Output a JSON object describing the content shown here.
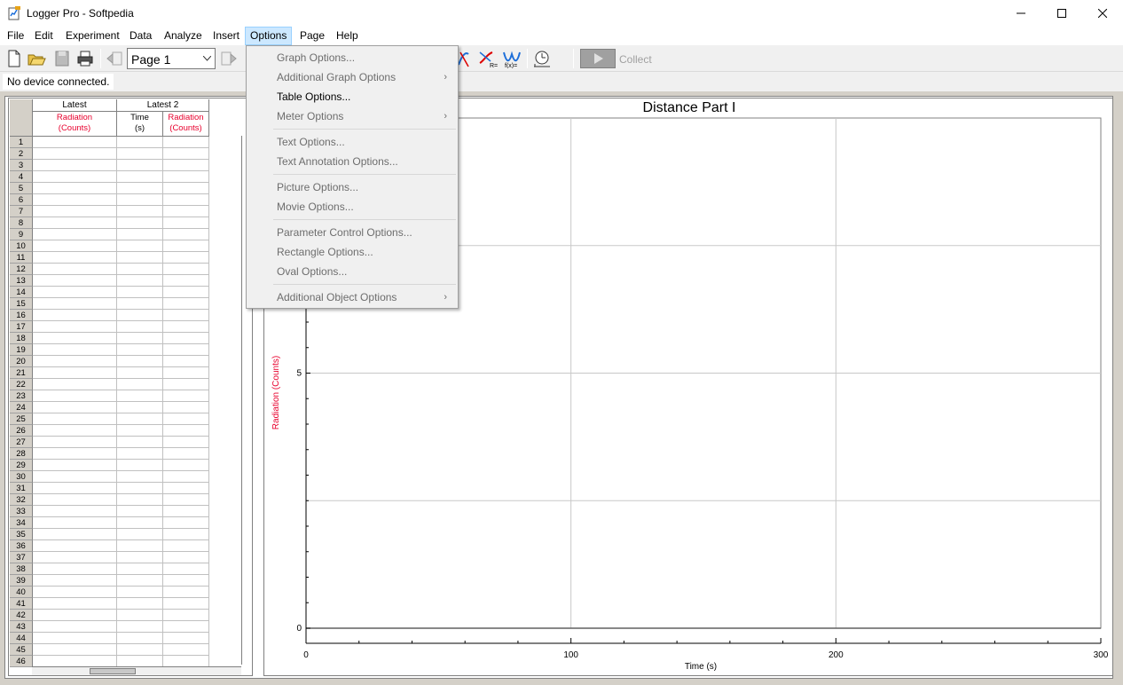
{
  "window": {
    "title": "Logger Pro - Softpedia"
  },
  "menubar": {
    "items": [
      "File",
      "Edit",
      "Experiment",
      "Data",
      "Analyze",
      "Insert",
      "Options",
      "Page",
      "Help"
    ]
  },
  "toolbar": {
    "page_select": "Page 1",
    "collect_label": "Collect"
  },
  "status": {
    "text": "No device connected."
  },
  "table": {
    "groups": [
      "Latest",
      "Latest 2"
    ],
    "columns": [
      {
        "name": "Radiation",
        "unit": "(Counts)",
        "color": "#e8002d"
      },
      {
        "name": "Time",
        "unit": "(s)",
        "color": "#000000"
      },
      {
        "name": "Radiation",
        "unit": "(Counts)",
        "color": "#e8002d"
      }
    ],
    "rows": [
      "1",
      "2",
      "3",
      "4",
      "5",
      "6",
      "7",
      "8",
      "9",
      "10",
      "11",
      "12",
      "13",
      "14",
      "15",
      "16",
      "17",
      "18",
      "19",
      "20",
      "21",
      "22",
      "23",
      "24",
      "25",
      "26",
      "27",
      "28",
      "29",
      "30",
      "31",
      "32",
      "33",
      "34",
      "35",
      "36",
      "37",
      "38",
      "39",
      "40",
      "41",
      "42",
      "43",
      "44",
      "45",
      "46"
    ]
  },
  "chart_data": {
    "type": "line",
    "title": "Distance Part I",
    "xlabel": "Time (s)",
    "ylabel": "Radiation (Counts)",
    "ylabel_color": "#e8002d",
    "x_ticks": [
      "0",
      "100",
      "200",
      "300"
    ],
    "y_ticks": [
      "0",
      "5"
    ],
    "xlim": [
      0,
      300
    ],
    "ylim": [
      0,
      10
    ],
    "grid": true,
    "series": []
  },
  "options_menu": {
    "items": [
      {
        "label": "Graph Options...",
        "enabled": false,
        "submenu": false
      },
      {
        "label": "Additional Graph Options",
        "enabled": false,
        "submenu": true
      },
      {
        "label": "Table Options...",
        "enabled": true,
        "submenu": false
      },
      {
        "label": "Meter Options",
        "enabled": false,
        "submenu": true
      },
      {
        "label": "Text Options...",
        "enabled": false,
        "submenu": false
      },
      {
        "label": "Text Annotation Options...",
        "enabled": false,
        "submenu": false
      },
      {
        "label": "Picture Options...",
        "enabled": false,
        "submenu": false
      },
      {
        "label": "Movie Options...",
        "enabled": false,
        "submenu": false
      },
      {
        "label": "Parameter Control Options...",
        "enabled": false,
        "submenu": false
      },
      {
        "label": "Rectangle Options...",
        "enabled": false,
        "submenu": false
      },
      {
        "label": "Oval Options...",
        "enabled": false,
        "submenu": false
      },
      {
        "label": "Additional Object Options",
        "enabled": false,
        "submenu": true
      }
    ]
  }
}
